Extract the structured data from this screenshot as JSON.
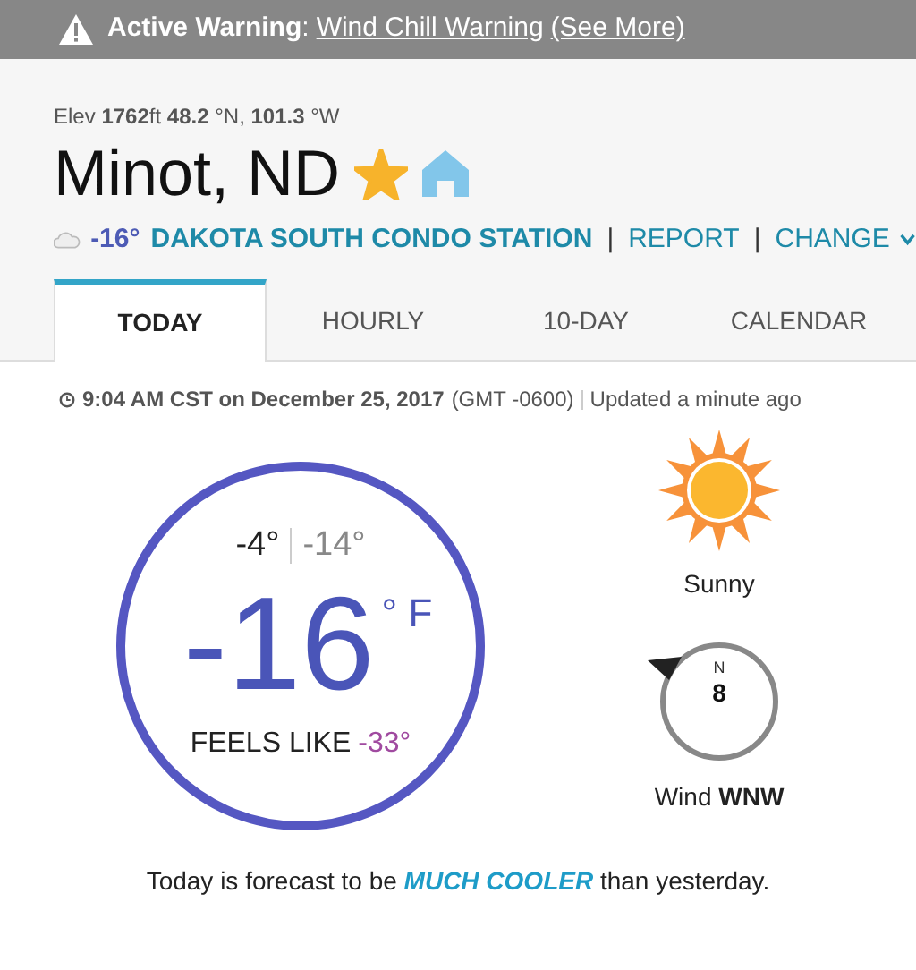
{
  "warning": {
    "label": "Active Warning",
    "separator": ":",
    "link": "Wind Chill Warning",
    "more": "(See More)"
  },
  "location": {
    "elevation": "Elev **1762**ft **48.2** °N, **101.3** °W",
    "city": "Minot, ND",
    "favorite": true,
    "station_temp": "-16°",
    "station": "DAKOTA SOUTH CONDO STATION",
    "sep1": "|",
    "report": "REPORT",
    "sep2": "|",
    "change": "CHANGE"
  },
  "tabs": [
    {
      "label": "TODAY",
      "selected": true
    },
    {
      "label": "HOURLY",
      "selected": false
    },
    {
      "label": "10-DAY",
      "selected": false
    },
    {
      "label": "CALENDAR",
      "selected": false
    }
  ],
  "observation": {
    "time": "9:04 AM CST on December 25, 2017",
    "offset": "(GMT -0600)",
    "updated": "Updated a minute ago"
  },
  "current": {
    "high": "-4°",
    "low": "-14°",
    "temp": "-16",
    "unit": "° F",
    "feels_label": "FEELS LIKE",
    "feels": "-33°"
  },
  "condition": {
    "label": "Sunny"
  },
  "wind": {
    "north": "N",
    "speed": "8",
    "text": "Wind **WNW**"
  },
  "forecast": "Today is forecast to be *MUCH COOLER* than yesterday."
}
